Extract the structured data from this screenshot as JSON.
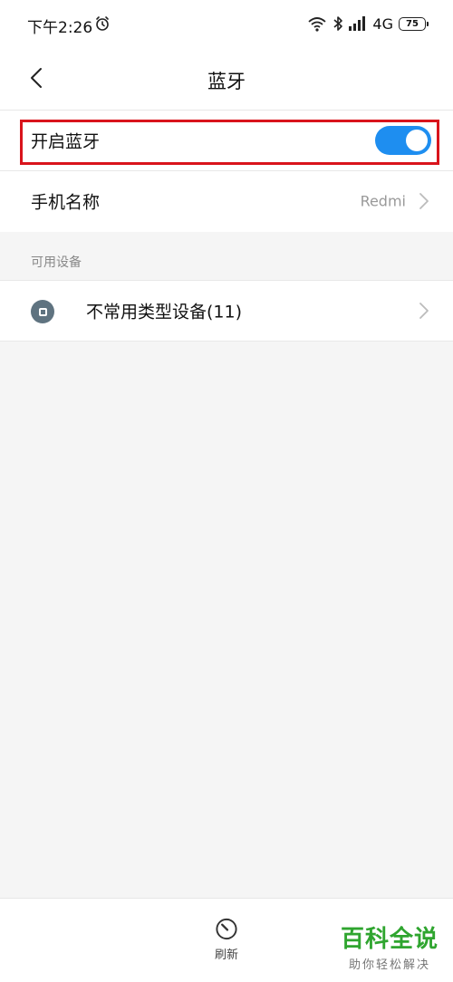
{
  "status_bar": {
    "time": "下午2:26",
    "network": "4G",
    "battery": "75"
  },
  "header": {
    "title": "蓝牙"
  },
  "bluetooth_toggle": {
    "label": "开启蓝牙",
    "on": true,
    "accent_color": "#1e8ef0"
  },
  "device_name_row": {
    "label": "手机名称",
    "value": "Redmi"
  },
  "available_devices": {
    "section_label": "可用设备",
    "items": [
      {
        "label": "不常用类型设备(11)"
      }
    ]
  },
  "bottom_bar": {
    "refresh_label": "刷新"
  },
  "watermark": {
    "title": "百科全说",
    "subtitle": "助你轻松解决"
  },
  "highlight_color": "#d9141c"
}
